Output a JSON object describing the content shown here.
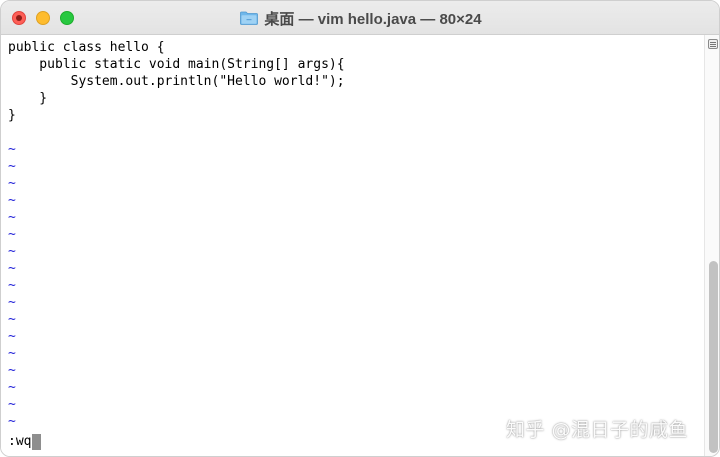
{
  "window": {
    "title": "桌面 — vim hello.java — 80×24"
  },
  "editor": {
    "code_lines": [
      "public class hello {",
      "    public static void main(String[] args){",
      "        System.out.println(\"Hello world!\");",
      "    }",
      "}",
      ""
    ],
    "empty_line_marker": "~",
    "command": ":wq"
  },
  "watermark": "知乎 @混日子的咸鱼",
  "colors": {
    "close": "#fe5f57",
    "minimize": "#febc2e",
    "maximize": "#28c840",
    "tilde": "#1f1fd8",
    "cursor": "#8e8e8e"
  },
  "icons": {
    "title_folder": "folder-icon",
    "scroll_indicator": "scroll-marker-icon"
  }
}
